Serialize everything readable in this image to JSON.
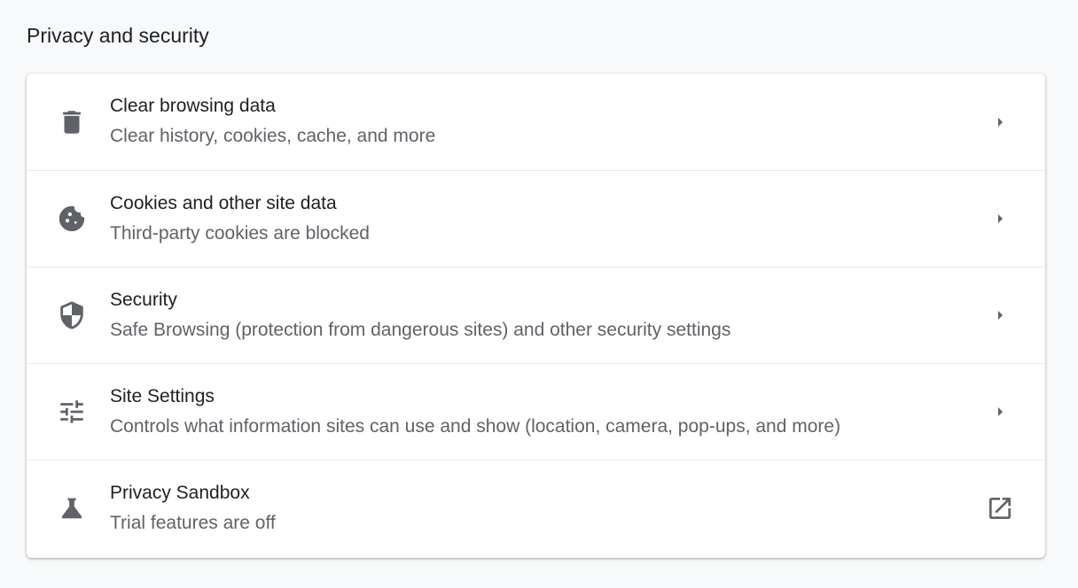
{
  "section": {
    "title": "Privacy and security"
  },
  "items": [
    {
      "label": "Clear browsing data",
      "sublabel": "Clear history, cookies, cache, and more",
      "icon": "trash-icon",
      "action_icon": "arrow-right-icon"
    },
    {
      "label": "Cookies and other site data",
      "sublabel": "Third-party cookies are blocked",
      "icon": "cookie-icon",
      "action_icon": "arrow-right-icon"
    },
    {
      "label": "Security",
      "sublabel": "Safe Browsing (protection from dangerous sites) and other security settings",
      "icon": "shield-icon",
      "action_icon": "arrow-right-icon"
    },
    {
      "label": "Site Settings",
      "sublabel": "Controls what information sites can use and show (location, camera, pop-ups, and more)",
      "icon": "tune-icon",
      "action_icon": "arrow-right-icon"
    },
    {
      "label": "Privacy Sandbox",
      "sublabel": "Trial features are off",
      "icon": "flask-icon",
      "action_icon": "open-in-new-icon"
    }
  ],
  "colors": {
    "background": "#f8f9fa",
    "card": "#ffffff",
    "primary_text": "#202124",
    "secondary_text": "#5f6368",
    "icon": "#5f6368",
    "divider": "#e8eaed"
  }
}
